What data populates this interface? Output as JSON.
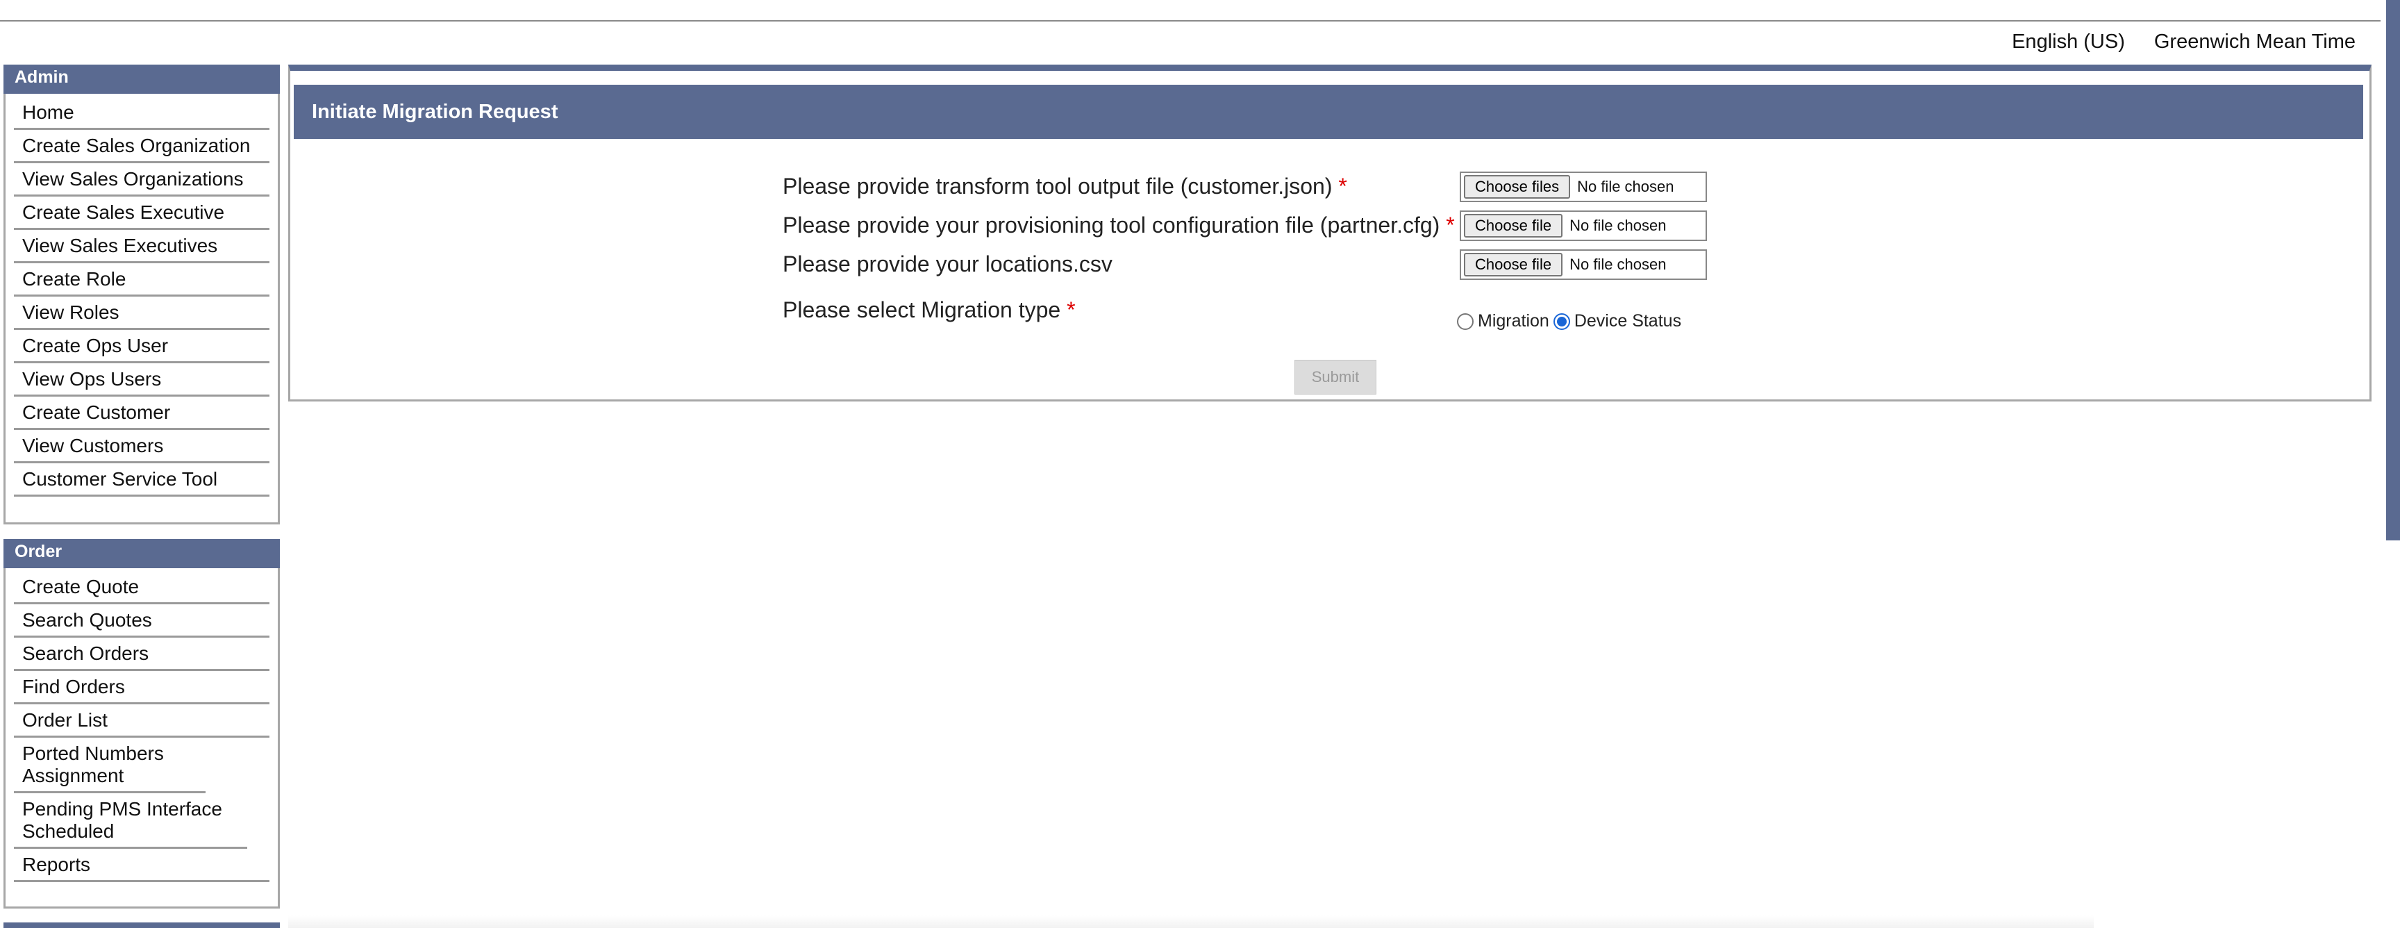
{
  "header": {
    "language": "English (US)",
    "timezone": "Greenwich Mean Time"
  },
  "sidebar": {
    "admin": {
      "title": "Admin",
      "items": [
        "Home",
        "Create Sales Organization",
        "View Sales Organizations",
        "Create Sales Executive",
        "View Sales Executives",
        "Create Role",
        "View Roles",
        "Create Ops User",
        "View Ops Users",
        "Create Customer",
        "View Customers",
        "Customer Service Tool"
      ]
    },
    "order": {
      "title": "Order",
      "items": [
        "Create Quote",
        "Search Quotes",
        "Search Orders",
        "Find Orders",
        "Order List",
        "Ported Numbers Assignment",
        "Pending PMS Interface Scheduled",
        "Reports"
      ]
    }
  },
  "main": {
    "title": "Initiate Migration Request",
    "fields": {
      "customer_json": {
        "label": "Please provide transform tool output file (customer.json)",
        "required_mark": "*",
        "button": "Choose files",
        "status": "No file chosen"
      },
      "partner_cfg": {
        "label": "Please provide your provisioning tool configuration file (partner.cfg)",
        "required_mark": "*",
        "button": "Choose file",
        "status": "No file chosen"
      },
      "locations_csv": {
        "label": "Please provide your locations.csv",
        "button": "Choose file",
        "status": "No file chosen"
      },
      "migration_type": {
        "label": "Please select Migration type",
        "required_mark": "*",
        "options": [
          "Migration",
          "Device Status"
        ],
        "selected": "Device Status"
      }
    },
    "submit_label": "Submit"
  },
  "colors": {
    "header_bg": "#5a6a91",
    "required": "#dd0000",
    "radio_selected": "#1a66d6"
  }
}
